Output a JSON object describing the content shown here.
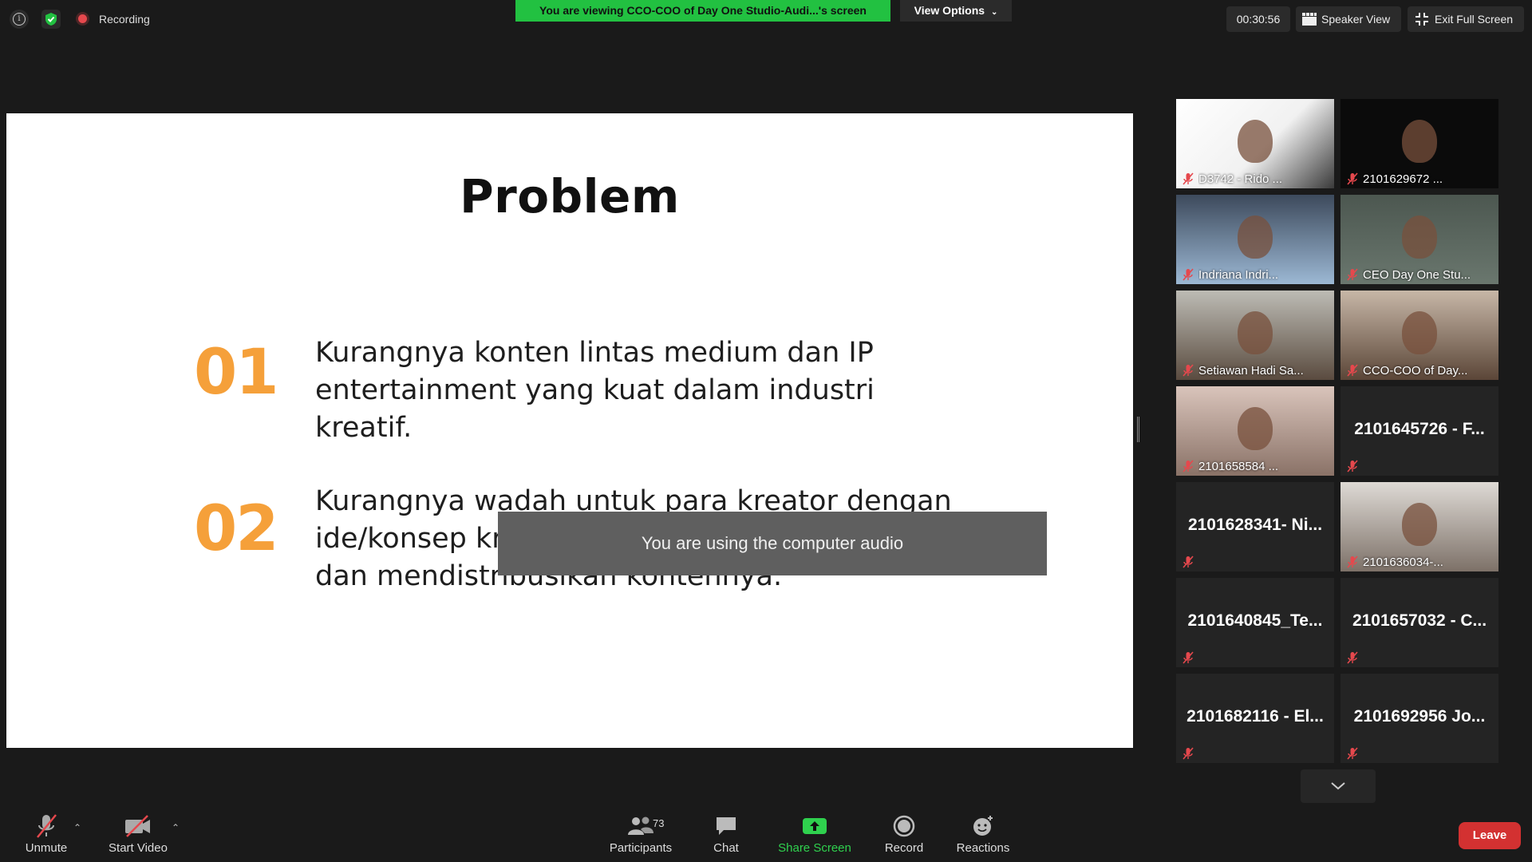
{
  "topbar": {
    "recording_label": "Recording",
    "viewing_banner": "You are viewing CCO-COO of Day One Studio-Audi...'s screen",
    "view_options_label": "View Options",
    "timer": "00:30:56",
    "speaker_view_label": "Speaker View",
    "exit_full_screen_label": "Exit Full Screen"
  },
  "slide": {
    "title": "Problem",
    "items": [
      {
        "number": "01",
        "text": "Kurangnya konten lintas medium dan IP entertainment yang kuat dalam industri kreatif."
      },
      {
        "number": "02",
        "text": "Kurangnya wadah untuk para kreator dengan ide/konsep kreatif dapat mengembangkan dan mendistribusikan kontennya."
      }
    ],
    "toast": "You are using the computer audio"
  },
  "gallery": {
    "tiles": [
      {
        "name": "D3742 - Rido ...",
        "type": "video"
      },
      {
        "name": "2101629672 ...",
        "type": "video"
      },
      {
        "name": "Indriana Indri...",
        "type": "video"
      },
      {
        "name": "CEO Day One Stu...",
        "type": "video",
        "active": true
      },
      {
        "name": "Setiawan Hadi Sa...",
        "type": "video"
      },
      {
        "name": "CCO-COO of Day...",
        "type": "video"
      },
      {
        "name": "2101658584 ...",
        "type": "video"
      },
      {
        "name": "2101645726 - F...",
        "type": "name-only"
      },
      {
        "name": "2101628341- Ni...",
        "type": "name-only"
      },
      {
        "name": "2101636034-...",
        "type": "video"
      },
      {
        "name": "2101640845_Te...",
        "type": "name-only"
      },
      {
        "name": "2101657032 - C...",
        "type": "name-only"
      },
      {
        "name": "2101682116 - El...",
        "type": "name-only"
      },
      {
        "name": "2101692956 Jo...",
        "type": "name-only"
      }
    ]
  },
  "toolbar": {
    "unmute_label": "Unmute",
    "start_video_label": "Start Video",
    "participants_label": "Participants",
    "participants_count": "73",
    "chat_label": "Chat",
    "share_screen_label": "Share Screen",
    "record_label": "Record",
    "reactions_label": "Reactions",
    "leave_label": "Leave"
  },
  "colors": {
    "accent_green": "#22c141",
    "slide_number_orange": "#f5a03a",
    "leave_red": "#d33131",
    "active_speaker": "#e7e06a"
  }
}
